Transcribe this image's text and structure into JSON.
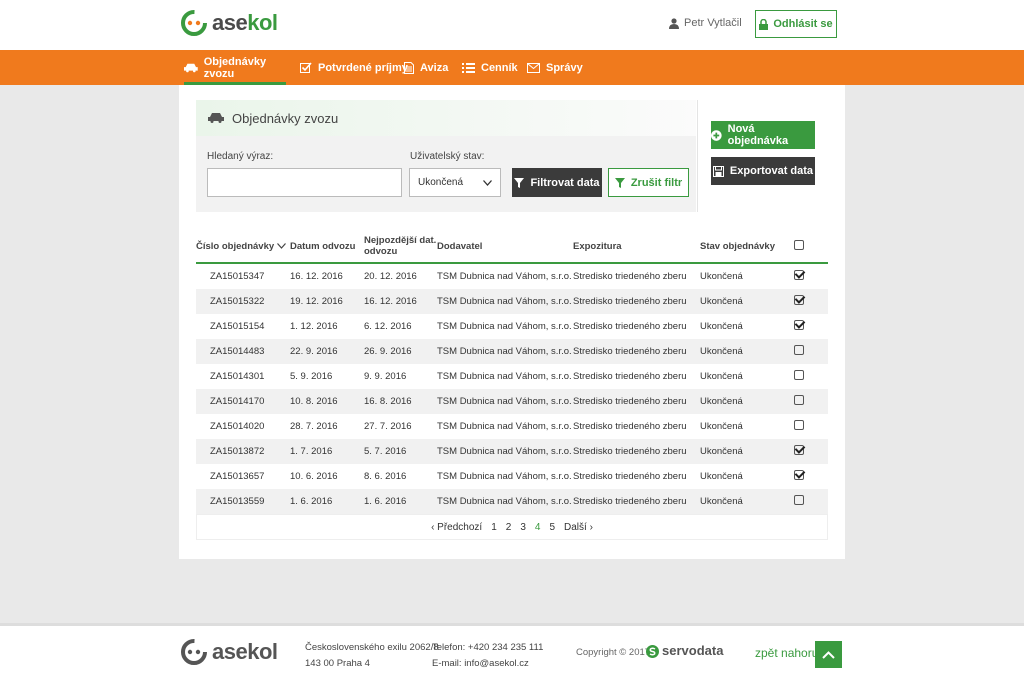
{
  "header": {
    "logo_text_a": "ase",
    "logo_text_b": "kol",
    "user_name": "Petr Vytlačil",
    "logout_label": "Odhlásit se"
  },
  "nav": [
    {
      "label": "Objednávky zvozu",
      "icon": "truck-icon",
      "active": true
    },
    {
      "label": "Potvrdené príjmy",
      "icon": "check-square-icon"
    },
    {
      "label": "Aviza",
      "icon": "document-icon"
    },
    {
      "label": "Cenník",
      "icon": "list-icon"
    },
    {
      "label": "Správy",
      "icon": "envelope-icon"
    }
  ],
  "filter": {
    "title": "Objednávky zvozu",
    "search_label": "Hledaný výraz:",
    "search_value": "",
    "state_label": "Uživatelský stav:",
    "state_value": "Ukončená",
    "filter_button": "Filtrovat data",
    "clear_button": "Zrušit filtr"
  },
  "actions": {
    "new_order": "Nová objednávka",
    "export": "Exportovat data"
  },
  "table": {
    "columns": [
      "Číslo objednávky",
      "Datum odvozu",
      "Nejpozdější dat. odvozu",
      "Dodavatel",
      "Expozitura",
      "Stav objednávky"
    ],
    "rows": [
      {
        "id": "ZA15015347",
        "date": "16. 12. 2016",
        "latest": "20. 12. 2016",
        "supplier": "TSM Dubnica nad Váhom, s.r.o.",
        "branch": "Stredisko triedeného zberu",
        "state": "Ukončená",
        "checked": true
      },
      {
        "id": "ZA15015322",
        "date": "19. 12. 2016",
        "latest": "16. 12. 2016",
        "supplier": "TSM Dubnica nad Váhom, s.r.o.",
        "branch": "Stredisko triedeného zberu",
        "state": "Ukončená",
        "checked": true
      },
      {
        "id": "ZA15015154",
        "date": "1. 12. 2016",
        "latest": "6. 12. 2016",
        "supplier": "TSM Dubnica nad Váhom, s.r.o.",
        "branch": "Stredisko triedeného zberu",
        "state": "Ukončená",
        "checked": true
      },
      {
        "id": "ZA15014483",
        "date": "22. 9. 2016",
        "latest": "26. 9. 2016",
        "supplier": "TSM Dubnica nad Váhom, s.r.o.",
        "branch": "Stredisko triedeného zberu",
        "state": "Ukončená",
        "checked": false
      },
      {
        "id": "ZA15014301",
        "date": "5. 9. 2016",
        "latest": "9. 9. 2016",
        "supplier": "TSM Dubnica nad Váhom, s.r.o.",
        "branch": "Stredisko triedeného zberu",
        "state": "Ukončená",
        "checked": false
      },
      {
        "id": "ZA15014170",
        "date": "10. 8. 2016",
        "latest": "16. 8. 2016",
        "supplier": "TSM Dubnica nad Váhom, s.r.o.",
        "branch": "Stredisko triedeného zberu",
        "state": "Ukončená",
        "checked": false
      },
      {
        "id": "ZA15014020",
        "date": "28. 7. 2016",
        "latest": "27. 7. 2016",
        "supplier": "TSM Dubnica nad Váhom, s.r.o.",
        "branch": "Stredisko triedeného zberu",
        "state": "Ukončená",
        "checked": false
      },
      {
        "id": "ZA15013872",
        "date": "1. 7. 2016",
        "latest": "5. 7. 2016",
        "supplier": "TSM Dubnica nad Váhom, s.r.o.",
        "branch": "Stredisko triedeného zberu",
        "state": "Ukončená",
        "checked": true
      },
      {
        "id": "ZA15013657",
        "date": "10. 6. 2016",
        "latest": "8. 6. 2016",
        "supplier": "TSM Dubnica nad Váhom, s.r.o.",
        "branch": "Stredisko triedeného zberu",
        "state": "Ukončená",
        "checked": true
      },
      {
        "id": "ZA15013559",
        "date": "1. 6. 2016",
        "latest": "1. 6. 2016",
        "supplier": "TSM Dubnica nad Váhom, s.r.o.",
        "branch": "Stredisko triedeného zberu",
        "state": "Ukončená",
        "checked": false
      }
    ]
  },
  "pager": {
    "prev": "‹ Předchozí",
    "pages": [
      "1",
      "2",
      "3",
      "4",
      "5"
    ],
    "current": "4",
    "next": "Další ›"
  },
  "footer": {
    "address_line1": "Československého exilu 2062/8",
    "address_line2": "143 00  Praha 4",
    "phone": "Telefon: +420 234 235 111",
    "email": "E-mail: info@asekol.cz",
    "copyright": "Copyright © 2017",
    "partner": "servodata",
    "back_top": "zpět nahoru"
  },
  "colors": {
    "orange": "#f07a1d",
    "green": "#3a9a3f",
    "dark": "#3b3b3b"
  }
}
